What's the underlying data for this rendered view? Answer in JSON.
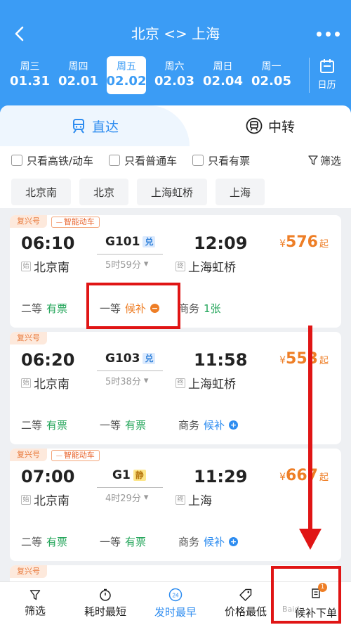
{
  "header": {
    "title": "北京 <> 上海",
    "dates": [
      {
        "weekday": "周三",
        "date": "01.31",
        "active": false
      },
      {
        "weekday": "周四",
        "date": "02.01",
        "active": false
      },
      {
        "weekday": "周五",
        "date": "02.02",
        "active": true
      },
      {
        "weekday": "周六",
        "date": "02.03",
        "active": false
      },
      {
        "weekday": "周日",
        "date": "02.04",
        "active": false
      },
      {
        "weekday": "周一",
        "date": "02.05",
        "active": false
      }
    ],
    "calendar_label": "日历"
  },
  "tabs": {
    "direct": "直达",
    "transfer": "中转"
  },
  "filters": {
    "high_speed": "只看高铁/动车",
    "normal": "只看普通车",
    "available": "只看有票",
    "filter": "筛选"
  },
  "stations": [
    "北京南",
    "北京",
    "上海虹桥",
    "上海"
  ],
  "trains": [
    {
      "type_badge": "复兴号",
      "smart_badge": "智能动车",
      "dep_time": "06:10",
      "train_no": "G101",
      "tag": "兑",
      "arr_time": "12:09",
      "duration": "5时59分",
      "dep_station": "北京南",
      "dep_mark": "始",
      "arr_station": "上海虹桥",
      "arr_mark": "终",
      "currency": "¥",
      "price": "576",
      "price_suffix": "起",
      "seat1_label": "二等",
      "seat1_status": "有票",
      "seat2_label": "一等",
      "seat2_status": "候补",
      "seat3_label": "商务",
      "seat3_status": "1张"
    },
    {
      "type_badge": "复兴号",
      "smart_badge": "",
      "dep_time": "06:20",
      "train_no": "G103",
      "tag": "兑",
      "arr_time": "11:58",
      "duration": "5时38分",
      "dep_station": "北京南",
      "dep_mark": "始",
      "arr_station": "上海虹桥",
      "arr_mark": "终",
      "currency": "¥",
      "price": "553",
      "price_suffix": "起",
      "seat1_label": "二等",
      "seat1_status": "有票",
      "seat2_label": "一等",
      "seat2_status": "有票",
      "seat3_label": "商务",
      "seat3_status": "候补"
    },
    {
      "type_badge": "复兴号",
      "smart_badge": "智能动车",
      "dep_time": "07:00",
      "train_no": "G1",
      "tag": "静",
      "arr_time": "11:29",
      "duration": "4时29分",
      "dep_station": "北京南",
      "dep_mark": "始",
      "arr_station": "上海",
      "arr_mark": "终",
      "currency": "¥",
      "price": "667",
      "price_suffix": "起",
      "seat1_label": "二等",
      "seat1_status": "有票",
      "seat2_label": "一等",
      "seat2_status": "有票",
      "seat3_label": "商务",
      "seat3_status": "候补"
    }
  ],
  "partial_card_badge": "复兴号",
  "bottom_bar": {
    "filter": "筛选",
    "shortest": "耗时最短",
    "earliest": "发时最早",
    "earliest_icon_text": "24",
    "cheapest": "价格最低",
    "waitlist": "候补下单",
    "waitlist_count": "1"
  },
  "watermark": "Baidu"
}
